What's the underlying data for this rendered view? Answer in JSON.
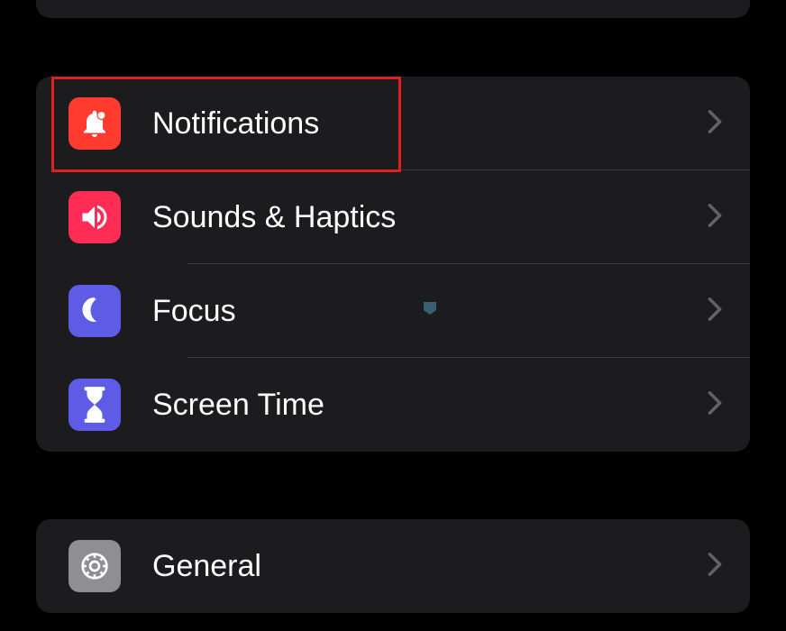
{
  "settings": {
    "group1": [
      {
        "id": "notifications",
        "label": "Notifications",
        "icon": "notifications",
        "iconColor": "#ff3b30"
      },
      {
        "id": "sounds",
        "label": "Sounds & Haptics",
        "icon": "sounds",
        "iconColor": "#ff2d55"
      },
      {
        "id": "focus",
        "label": "Focus",
        "icon": "focus",
        "iconColor": "#5e5ce6"
      },
      {
        "id": "screentime",
        "label": "Screen Time",
        "icon": "screentime",
        "iconColor": "#5e5ce6"
      }
    ],
    "group2": [
      {
        "id": "general",
        "label": "General",
        "icon": "general",
        "iconColor": "#8e8e93"
      }
    ]
  },
  "highlighted": "notifications"
}
